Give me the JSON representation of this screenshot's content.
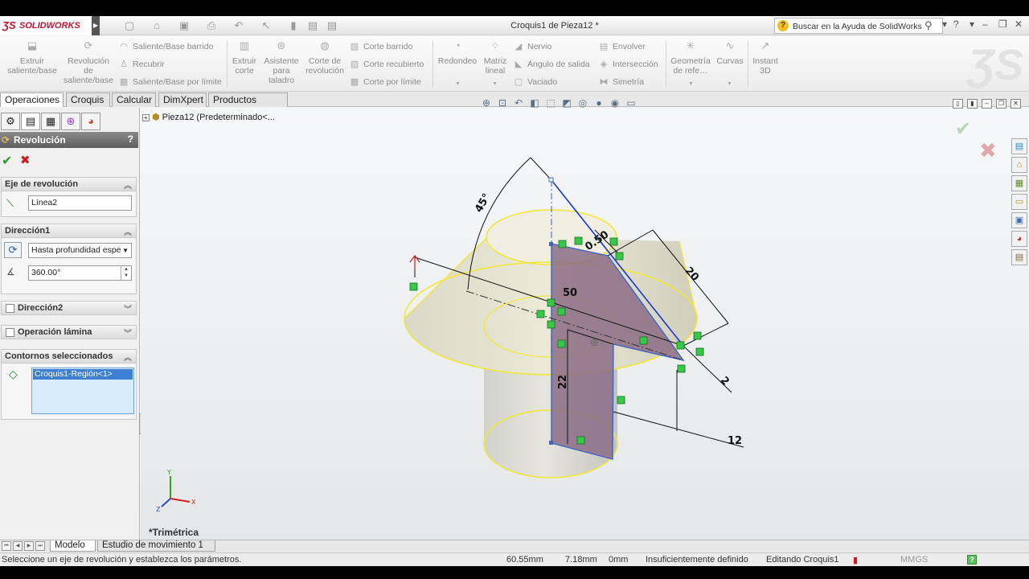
{
  "window": {
    "title": "Croquis1 de Pieza12 *",
    "brand": "SOLIDWORKS",
    "help_search_placeholder": "Buscar en la Ayuda de SolidWorks"
  },
  "ribbon": {
    "big_buttons": [
      {
        "label": "Extruir saliente/base",
        "icon": "extrude-icon"
      },
      {
        "label": "Revolución de saliente/base",
        "icon": "revolve-icon"
      },
      {
        "label": "Extruir corte",
        "icon": "extruded-cut-icon"
      },
      {
        "label": "Asistente para taladro",
        "icon": "hole-wizard-icon"
      },
      {
        "label": "Corte de revolución",
        "icon": "revolved-cut-icon"
      },
      {
        "label": "Redondeo",
        "icon": "fillet-icon"
      },
      {
        "label": "Matriz lineal",
        "icon": "linear-pattern-icon"
      },
      {
        "label": "Geometría de refe…",
        "icon": "reference-geometry-icon"
      },
      {
        "label": "Curvas",
        "icon": "curves-icon"
      },
      {
        "label": "Instant 3D",
        "icon": "instant3d-icon"
      }
    ],
    "small_buttons": [
      {
        "label": "Saliente/Base barrido",
        "icon": "sweep-icon"
      },
      {
        "label": "Recubrir",
        "icon": "loft-icon"
      },
      {
        "label": "Saliente/Base por límite",
        "icon": "boundary-icon"
      },
      {
        "label": "Corte barrido",
        "icon": "swept-cut-icon"
      },
      {
        "label": "Corte recubierto",
        "icon": "lofted-cut-icon"
      },
      {
        "label": "Corte por límite",
        "icon": "boundary-cut-icon"
      },
      {
        "label": "Nervio",
        "icon": "rib-icon"
      },
      {
        "label": "Ángulo de salida",
        "icon": "draft-icon"
      },
      {
        "label": "Vaciado",
        "icon": "shell-icon"
      },
      {
        "label": "Envolver",
        "icon": "wrap-icon"
      },
      {
        "label": "Intersección",
        "icon": "intersect-icon"
      },
      {
        "label": "Simetría",
        "icon": "mirror-icon"
      }
    ]
  },
  "tabs": [
    "Operaciones",
    "Croquis",
    "Calcular",
    "DimXpert",
    "Productos Office"
  ],
  "property_manager": {
    "title": "Revolución",
    "help": "?",
    "axis_group": "Eje de revolución",
    "axis_value": "Línea2",
    "direction1_group": "Dirección1",
    "direction1_type": "Hasta profundidad espe",
    "direction1_angle": "360.00°",
    "direction2_group": "Dirección2",
    "thin_group": "Operación lámina",
    "contours_group": "Contornos seleccionados",
    "contour_item": "Croquis1-Región<1>"
  },
  "viewport": {
    "tree_root": "Pieza12  (Predeterminado<...",
    "view_label": "*Trimétrica",
    "dimensions": {
      "angle": "45°",
      "d1": "0.50",
      "d2": "20",
      "d3": "50",
      "d4": "22",
      "d5": "12",
      "d6": "2"
    },
    "triad": {
      "x": "X",
      "y": "Y",
      "z": "Z"
    }
  },
  "bottom_tabs": [
    "Modelo",
    "Estudio de movimiento 1"
  ],
  "status": {
    "message": "Seleccione un eje de revolución y establezca los parámetros.",
    "x": "60.55mm",
    "y": "7.18mm",
    "z": "0mm",
    "definition": "Insuficientemente definido",
    "mode": "Editando Croquis1",
    "units": "MMGS",
    "help": "?"
  }
}
